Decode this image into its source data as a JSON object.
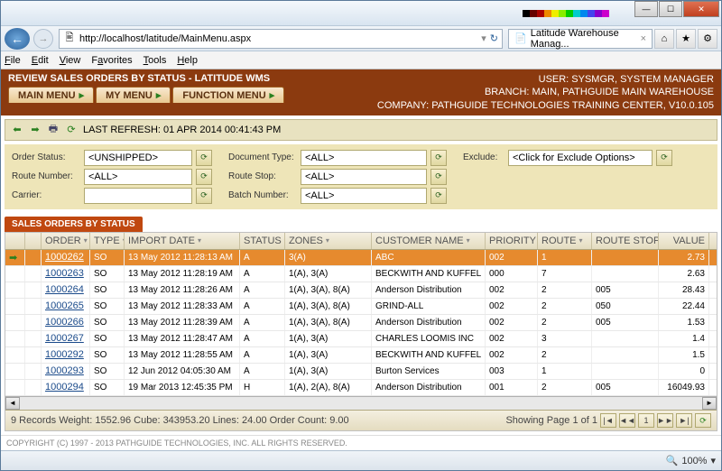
{
  "browser": {
    "url": "http://localhost/latitude/MainMenu.aspx",
    "tab_title": "Latitude Warehouse Manag...",
    "menus": [
      "File",
      "Edit",
      "View",
      "Favorites",
      "Tools",
      "Help"
    ],
    "zoom": "100%"
  },
  "header": {
    "title": "REVIEW SALES ORDERS BY STATUS - LATITUDE WMS",
    "user": "USER: SYSMGR, SYSTEM MANAGER",
    "branch": "BRANCH: MAIN, PATHGUIDE MAIN WAREHOUSE",
    "company": "COMPANY: PATHGUIDE TECHNOLOGIES TRAINING CENTER, V10.0.105",
    "tabs": [
      "MAIN MENU",
      "MY MENU",
      "FUNCTION MENU"
    ]
  },
  "refresh": {
    "label": "LAST REFRESH: 01 APR 2014 00:41:43 PM"
  },
  "filters": {
    "order_status_label": "Order Status:",
    "order_status": "<UNSHIPPED>",
    "route_number_label": "Route Number:",
    "route_number": "<ALL>",
    "carrier_label": "Carrier:",
    "carrier": "",
    "doc_type_label": "Document Type:",
    "doc_type": "<ALL>",
    "route_stop_label": "Route Stop:",
    "route_stop": "<ALL>",
    "batch_number_label": "Batch Number:",
    "batch_number": "<ALL>",
    "exclude_label": "Exclude:",
    "exclude": "<Click for Exclude Options>"
  },
  "grid": {
    "section": "SALES ORDERS BY STATUS",
    "cols": [
      "ORDER",
      "TYPE",
      "IMPORT DATE",
      "STATUS",
      "ZONES",
      "CUSTOMER NAME",
      "PRIORITY",
      "ROUTE",
      "ROUTE STOP",
      "VALUE"
    ],
    "rows": [
      {
        "order": "1000262",
        "type": "SO",
        "imp": "13 May 2012 11:28:13 AM",
        "status": "A",
        "zones": "3(A)",
        "cust": "ABC",
        "pri": "002",
        "route": "1",
        "rstop": "",
        "val": "2.73"
      },
      {
        "order": "1000263",
        "type": "SO",
        "imp": "13 May 2012 11:28:19 AM",
        "status": "A",
        "zones": "1(A), 3(A)",
        "cust": "BECKWITH AND KUFFEL",
        "pri": "000",
        "route": "7",
        "rstop": "",
        "val": "2.63"
      },
      {
        "order": "1000264",
        "type": "SO",
        "imp": "13 May 2012 11:28:26 AM",
        "status": "A",
        "zones": "1(A), 3(A), 8(A)",
        "cust": "Anderson Distribution",
        "pri": "002",
        "route": "2",
        "rstop": "005",
        "val": "28.43"
      },
      {
        "order": "1000265",
        "type": "SO",
        "imp": "13 May 2012 11:28:33 AM",
        "status": "A",
        "zones": "1(A), 3(A), 8(A)",
        "cust": "GRIND-ALL",
        "pri": "002",
        "route": "2",
        "rstop": "050",
        "val": "22.44"
      },
      {
        "order": "1000266",
        "type": "SO",
        "imp": "13 May 2012 11:28:39 AM",
        "status": "A",
        "zones": "1(A), 3(A), 8(A)",
        "cust": "Anderson Distribution",
        "pri": "002",
        "route": "2",
        "rstop": "005",
        "val": "1.53"
      },
      {
        "order": "1000267",
        "type": "SO",
        "imp": "13 May 2012 11:28:47 AM",
        "status": "A",
        "zones": "1(A), 3(A)",
        "cust": "CHARLES LOOMIS INC",
        "pri": "002",
        "route": "3",
        "rstop": "",
        "val": "1.4"
      },
      {
        "order": "1000292",
        "type": "SO",
        "imp": "13 May 2012 11:28:55 AM",
        "status": "A",
        "zones": "1(A), 3(A)",
        "cust": "BECKWITH AND KUFFEL",
        "pri": "002",
        "route": "2",
        "rstop": "",
        "val": "1.5"
      },
      {
        "order": "1000293",
        "type": "SO",
        "imp": "12 Jun 2012 04:05:30 AM",
        "status": "A",
        "zones": "1(A), 3(A)",
        "cust": "Burton Services",
        "pri": "003",
        "route": "1",
        "rstop": "",
        "val": "0"
      },
      {
        "order": "1000294",
        "type": "SO",
        "imp": "19 Mar 2013 12:45:35 PM",
        "status": "H",
        "zones": "1(A), 2(A), 8(A)",
        "cust": "Anderson Distribution",
        "pri": "001",
        "route": "2",
        "rstop": "005",
        "val": "16049.93"
      }
    ],
    "footer": "9 Records Weight: 1552.96 Cube: 343953.20 Lines: 24.00 Order Count: 9.00",
    "pager": "Showing Page 1 of 1"
  },
  "copyright": "COPYRIGHT (C) 1997 - 2013 PATHGUIDE TECHNOLOGIES, INC. ALL RIGHTS RESERVED."
}
